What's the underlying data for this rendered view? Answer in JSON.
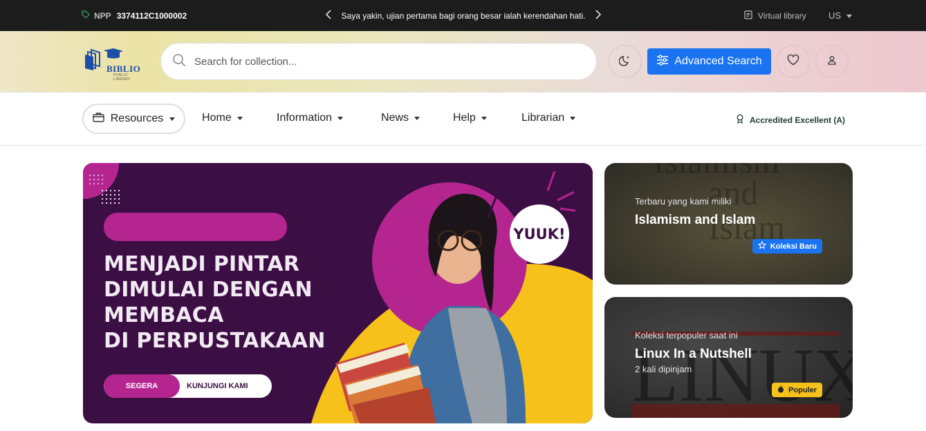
{
  "topbar": {
    "npp_label": "NPP",
    "npp_value": "3374112C1000002",
    "quote": "Saya yakin, ujian pertama bagi orang besar ialah kerendahan hati.",
    "virtual_library": "Virtual library",
    "language": "US"
  },
  "header": {
    "logo_text": "BIBLIO",
    "logo_subtext": "PUBLIC LIBRARY",
    "search_placeholder": "Search for collection...",
    "advanced_search_label": "Advanced Search"
  },
  "nav": {
    "resources_label": "Resources",
    "items": [
      "Home",
      "Information",
      "News",
      "Help",
      "Librarian"
    ],
    "accreditation": "Accredited Excellent (A)"
  },
  "banner": {
    "headline": [
      "MENJADI PINTAR",
      "DIMULAI DENGAN",
      "MEMBACA",
      "DI PERPUSTAKAAN"
    ],
    "badge": "YUUK!",
    "cta_left": "SEGERA",
    "cta_right": "KUNJUNGI KAMI"
  },
  "cards": [
    {
      "kicker": "Terbaru yang kami miliki",
      "title": "Islamism and Islam",
      "badge": "Koleksi Baru",
      "badge_color": "#1a73f0"
    },
    {
      "kicker": "Koleksi terpopuler saat ini",
      "title": "Linux In a Nutshell",
      "subtitle": "2 kali dipinjam",
      "badge": "Populer",
      "badge_color": "#f6c11a"
    }
  ],
  "colors": {
    "accent": "#1a73f0",
    "banner_purple": "#3b0e44",
    "banner_magenta": "#b4258f",
    "banner_yellow": "#f6c11a"
  },
  "icons": [
    "tag-icon",
    "chevron-left-icon",
    "chevron-right-icon",
    "document-icon",
    "search-icon",
    "moon-icon",
    "sliders-icon",
    "heart-icon",
    "user-icon",
    "briefcase-icon",
    "award-icon",
    "star-icon",
    "fire-icon"
  ]
}
